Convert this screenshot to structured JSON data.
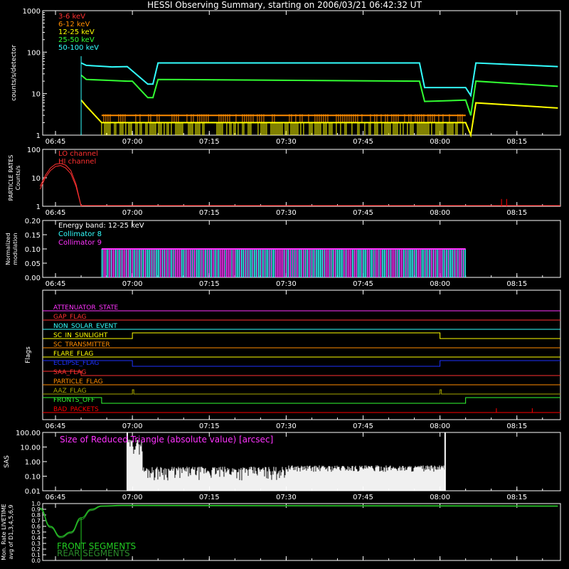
{
  "title": "HESSI Observing Summary, starting on 2006/03/21 06:42:32 UT",
  "time_ticks": [
    "06:45",
    "07:00",
    "07:15",
    "07:30",
    "07:45",
    "08:00",
    "08:15"
  ],
  "colors": {
    "c3_6": "#ff3030",
    "c6_12": "#ff8c00",
    "c12_25": "#ffff00",
    "c25_50": "#33ff33",
    "c50_100": "#33ffff",
    "magenta": "#ff33ff",
    "white": "#ffffff",
    "red": "#ff0000",
    "blue": "#1e32ff",
    "green": "#22cc22",
    "olive": "#a8a800"
  },
  "chart_data": [
    {
      "type": "line",
      "name": "count-rates",
      "ylabel": "counts/s/detector",
      "yscale": "log",
      "ylim": [
        1,
        1000
      ],
      "ytick_labels": [
        "1",
        "10",
        "100",
        "1000"
      ],
      "x_unit": "UT",
      "legend": [
        "3-6 keV",
        "6-12 keV",
        "12-25 keV",
        "25-50 keV",
        "50-100 keV"
      ],
      "series": [
        {
          "name": "50-100 keV",
          "color": "#33ffff",
          "x": [
            "06:50",
            "06:51",
            "06:55",
            "06:56",
            "06:59",
            "07:03",
            "07:04",
            "07:05",
            "07:56",
            "07:57",
            "08:05",
            "08:06",
            "08:07",
            "08:23"
          ],
          "values": [
            55,
            48,
            45,
            44,
            45,
            17,
            17,
            55,
            55,
            14,
            14,
            9,
            55,
            45
          ]
        },
        {
          "name": "25-50 keV",
          "color": "#33ff33",
          "x": [
            "06:50",
            "06:51",
            "06:55",
            "06:59",
            "07:00",
            "07:03",
            "07:04",
            "07:05",
            "07:56",
            "07:57",
            "08:05",
            "08:06",
            "08:07",
            "08:23"
          ],
          "values": [
            28,
            22,
            21,
            20,
            20,
            8,
            8,
            22,
            20,
            6.5,
            7,
            3,
            20,
            15
          ]
        },
        {
          "name": "12-25 keV",
          "color": "#ffff00",
          "x": [
            "06:50",
            "06:51",
            "06:54",
            "08:05",
            "08:06",
            "08:07",
            "08:23"
          ],
          "values": [
            7,
            5,
            2,
            2,
            1,
            6,
            4.5
          ]
        },
        {
          "name": "6-12 keV",
          "color": "#ff8c00",
          "x": [
            "06:54",
            "08:05"
          ],
          "values": [
            3,
            3
          ]
        }
      ]
    },
    {
      "type": "line",
      "name": "particle-rates",
      "ylabel": "PARTICLE RATES Counts/s",
      "yscale": "log",
      "ylim": [
        1,
        100
      ],
      "ytick_labels": [
        "1",
        "10",
        "100"
      ],
      "legend": [
        "LO channel",
        "HI channel"
      ],
      "series": [
        {
          "name": "LO channel",
          "color": "#ff3030",
          "x": [
            "06:42",
            "06:43",
            "06:44",
            "06:45",
            "06:46",
            "06:47",
            "06:48",
            "06:49",
            "06:50"
          ],
          "values": [
            5,
            12,
            22,
            30,
            32,
            28,
            18,
            6,
            1
          ]
        },
        {
          "name": "HI channel",
          "color": "#ff3030",
          "x": [
            "06:42",
            "06:43",
            "06:44",
            "06:45",
            "06:46",
            "06:47",
            "06:48",
            "06:49",
            "06:50"
          ],
          "values": [
            4,
            10,
            18,
            25,
            27,
            22,
            14,
            5,
            1
          ]
        }
      ],
      "spikes_x": [
        "08:12",
        "08:13"
      ],
      "spikes_y": [
        1.8,
        1.8
      ]
    },
    {
      "type": "line",
      "name": "modulation",
      "ylabel": "Normalized modulation",
      "ylim": [
        0,
        0.2
      ],
      "ytick_labels": [
        "0.00",
        "0.05",
        "0.10",
        "0.15",
        "0.20"
      ],
      "legend_title": "Energy band: 12-25 keV",
      "legend": [
        "Collimator 8",
        "Collimator 9"
      ],
      "series": [
        {
          "name": "Collimator 8",
          "color": "#33ffff",
          "x_range": [
            "06:54",
            "08:05"
          ],
          "baseline": 0.1
        },
        {
          "name": "Collimator 9",
          "color": "#ff33ff",
          "x_range": [
            "06:54",
            "08:05"
          ],
          "baseline": 0.1
        }
      ]
    },
    {
      "type": "line",
      "name": "flags",
      "ylabel": "Flags",
      "flags": [
        {
          "name": "ATTENUATOR_STATE",
          "color": "#ff33ff"
        },
        {
          "name": "GAP_FLAG",
          "color": "#ff3030"
        },
        {
          "name": "NON_SOLAR_EVENT",
          "color": "#33ffff"
        },
        {
          "name": "SC_IN_SUNLIGHT",
          "color": "#ffff00"
        },
        {
          "name": "SC_TRANSMITTER",
          "color": "#ff8c00"
        },
        {
          "name": "FLARE_FLAG",
          "color": "#ffff00"
        },
        {
          "name": "ECLIPSE_FLAG",
          "color": "#1e32ff"
        },
        {
          "name": "SAA_FLAG",
          "color": "#ff3030"
        },
        {
          "name": "PARTICLE_FLAG",
          "color": "#ff8c00"
        },
        {
          "name": "AAZ_FLAG",
          "color": "#a8a800"
        },
        {
          "name": "FRONTS_OFF",
          "color": "#33ff33"
        },
        {
          "name": "BAD_PACKETS",
          "color": "#ff0000"
        }
      ]
    },
    {
      "type": "line",
      "name": "sas",
      "ylabel": "SAS",
      "yscale": "log",
      "ylim": [
        0.01,
        100
      ],
      "ytick_labels": [
        "0.01",
        "0.10",
        "1.00",
        "10.00",
        "100.00"
      ],
      "annotation": "Size of Reduced Triangle (absolute value) [arcsec]",
      "series": [
        {
          "name": "Size of Reduced Triangle",
          "color": "#ffffff",
          "x": [
            "06:59",
            "07:00",
            "07:01",
            "07:30",
            "07:31",
            "08:00",
            "08:01"
          ],
          "values": [
            100,
            3,
            0.5,
            0.2,
            0.3,
            0.35,
            100
          ]
        }
      ]
    },
    {
      "type": "line",
      "name": "livetime",
      "ylabel": "Mon. Rate LIVETIME avg of D1,3,4,5,6,9",
      "ylim": [
        0.0,
        1.0
      ],
      "ytick_labels": [
        "0.0",
        "0.1",
        "0.2",
        "0.3",
        "0.4",
        "0.5",
        "0.6",
        "0.7",
        "0.8",
        "0.9",
        "1.0"
      ],
      "legend": [
        "FRONT SEGMENTS",
        "REAR SEGMENTS"
      ],
      "series": [
        {
          "name": "FRONT SEGMENTS",
          "color": "#22cc22",
          "x": [
            "06:42",
            "06:44",
            "06:46",
            "06:48",
            "06:50",
            "06:52",
            "06:54",
            "06:58",
            "08:23"
          ],
          "values": [
            0.92,
            0.6,
            0.42,
            0.5,
            0.75,
            0.9,
            0.96,
            0.97,
            0.96
          ]
        },
        {
          "name": "REAR SEGMENTS",
          "color": "#2a8a2a",
          "x": [
            "06:42",
            "06:44",
            "06:46",
            "06:48",
            "06:50",
            "06:52",
            "06:54",
            "06:58",
            "08:23"
          ],
          "values": [
            0.9,
            0.58,
            0.4,
            0.48,
            0.72,
            0.88,
            0.95,
            0.96,
            0.95
          ]
        }
      ]
    }
  ]
}
